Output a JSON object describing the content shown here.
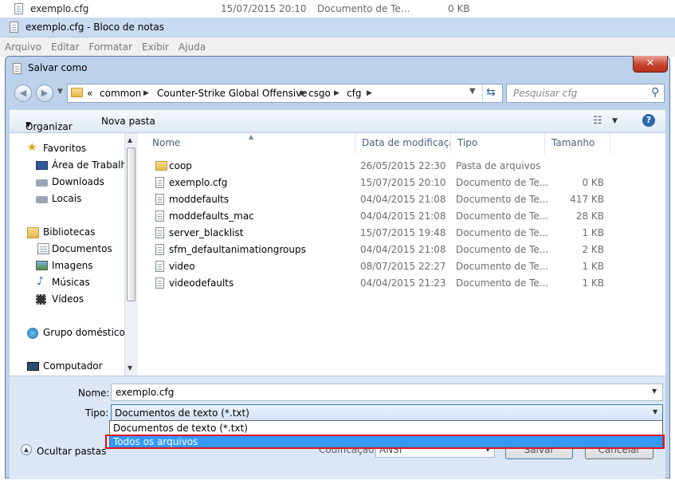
{
  "background_row": {
    "filename": "exemplo.cfg",
    "date": "15/07/2015 20:10",
    "type": "Documento de Te...",
    "size": "0 KB"
  },
  "notepad": {
    "title": "exemplo.cfg - Bloco de notas",
    "menu": [
      "Arquivo",
      "Editar",
      "Formatar",
      "Exibir",
      "Ajuda"
    ]
  },
  "dialog": {
    "title": "Salvar como",
    "close_label": "✕",
    "breadcrumb": {
      "prefix": "«",
      "parts": [
        "common",
        "Counter-Strike Global Offensive",
        "csgo",
        "cfg"
      ]
    },
    "search_placeholder": "Pesquisar cfg",
    "toolbar": {
      "organize_label": "Organizar",
      "new_folder_label": "Nova pasta"
    },
    "nav": {
      "favorites": "Favoritos",
      "desktop": "Área de Trabalho",
      "downloads": "Downloads",
      "places": "Locais",
      "libraries": "Bibliotecas",
      "documents": "Documentos",
      "images": "Imagens",
      "music": "Músicas",
      "videos": "Vídeos",
      "homegroup": "Grupo doméstico",
      "computer": "Computador"
    },
    "columns": [
      "Nome",
      "Data de modificaçã...",
      "Tipo",
      "Tamanho"
    ],
    "files": [
      {
        "name": "coop",
        "date": "26/05/2015 22:30",
        "type": "Pasta de arquivos",
        "size": "",
        "folder": true
      },
      {
        "name": "exemplo.cfg",
        "date": "15/07/2015 20:10",
        "type": "Documento de Te...",
        "size": "0 KB",
        "folder": false
      },
      {
        "name": "moddefaults",
        "date": "04/04/2015 21:08",
        "type": "Documento de Te...",
        "size": "417 KB",
        "folder": false
      },
      {
        "name": "moddefaults_mac",
        "date": "04/04/2015 21:08",
        "type": "Documento de Te...",
        "size": "28 KB",
        "folder": false
      },
      {
        "name": "server_blacklist",
        "date": "15/07/2015 19:48",
        "type": "Documento de Te...",
        "size": "1 KB",
        "folder": false
      },
      {
        "name": "sfm_defaultanimationgroups",
        "date": "04/04/2015 21:08",
        "type": "Documento de Te...",
        "size": "2 KB",
        "folder": false
      },
      {
        "name": "video",
        "date": "08/07/2015 22:27",
        "type": "Documento de Te...",
        "size": "1 KB",
        "folder": false
      },
      {
        "name": "videodefaults",
        "date": "04/04/2015 21:23",
        "type": "Documento de Te...",
        "size": "1 KB",
        "folder": false
      }
    ],
    "form": {
      "name_label": "Nome:",
      "name_value": "exemplo.cfg",
      "type_label": "Tipo:",
      "type_value": "Documentos de texto (*.txt)",
      "type_options": [
        "Documentos de texto (*.txt)",
        "Todos os arquivos"
      ],
      "hide_folders_label": "Ocultar pastas",
      "encoding_label": "Codificação:",
      "encoding_value": "ANSI",
      "save_label": "Salvar",
      "cancel_label": "Cancelar"
    }
  },
  "colors": {
    "selection": "#3399ff",
    "highlight_box": "#e0101c",
    "window_frame": "#bcd1ea",
    "close_button": "#c7432c"
  }
}
